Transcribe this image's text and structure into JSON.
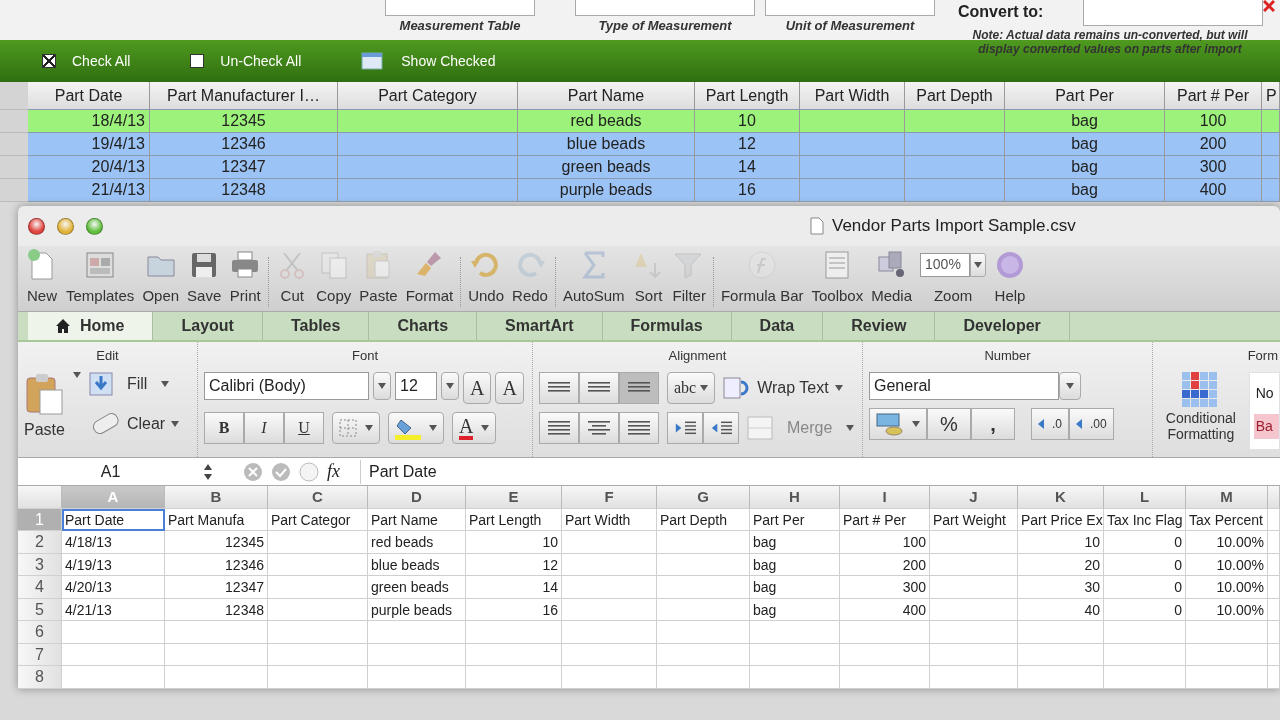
{
  "background_app": {
    "field_labels": [
      "Measurement Table",
      "Type of Measurement",
      "Unit of Measurement"
    ],
    "convert_label": "Convert to:",
    "note": "Note: Actual data remains un-converted, but will display converted values on parts after import",
    "controls": [
      {
        "kind": "checkbox",
        "label": "Check All",
        "checked": true
      },
      {
        "kind": "checkbox",
        "label": "Un-Check All",
        "checked": false
      },
      {
        "kind": "button",
        "label": "Show Checked"
      }
    ],
    "table": {
      "columns": [
        "Part Date",
        "Part Manufacturer I…",
        "Part Category",
        "Part Name",
        "Part Length",
        "Part Width",
        "Part Depth",
        "Part Per",
        "Part # Per",
        "P"
      ],
      "rows": [
        {
          "selected": true,
          "part_date": "18/4/13",
          "part_manufacturer": "12345",
          "part_name": "red beads",
          "part_length": "10",
          "part_per": "bag",
          "part_num_per": "100"
        },
        {
          "selected": false,
          "part_date": "19/4/13",
          "part_manufacturer": "12346",
          "part_name": "blue beads",
          "part_length": "12",
          "part_per": "bag",
          "part_num_per": "200"
        },
        {
          "selected": false,
          "part_date": "20/4/13",
          "part_manufacturer": "12347",
          "part_name": "green beads",
          "part_length": "14",
          "part_per": "bag",
          "part_num_per": "300"
        },
        {
          "selected": false,
          "part_date": "21/4/13",
          "part_manufacturer": "12348",
          "part_name": "purple beads",
          "part_length": "16",
          "part_per": "bag",
          "part_num_per": "400"
        }
      ]
    }
  },
  "excel": {
    "title": "Vendor Parts Import Sample.csv",
    "toolbar": [
      {
        "label": "New",
        "disabled": false
      },
      {
        "label": "Templates",
        "disabled": false
      },
      {
        "label": "Open",
        "disabled": false
      },
      {
        "label": "Save",
        "disabled": false
      },
      {
        "label": "Print",
        "disabled": false
      },
      {
        "label": "Cut",
        "disabled": true
      },
      {
        "label": "Copy",
        "disabled": true
      },
      {
        "label": "Paste",
        "disabled": true
      },
      {
        "label": "Format",
        "disabled": false
      },
      {
        "label": "Undo",
        "disabled": false
      },
      {
        "label": "Redo",
        "disabled": true
      },
      {
        "label": "AutoSum",
        "disabled": true
      },
      {
        "label": "Sort",
        "disabled": true
      },
      {
        "label": "Filter",
        "disabled": true
      },
      {
        "label": "Formula Bar",
        "disabled": true
      },
      {
        "label": "Toolbox",
        "disabled": false
      },
      {
        "label": "Media",
        "disabled": false
      },
      {
        "label": "Zoom",
        "disabled": false
      },
      {
        "label": "Help",
        "disabled": false
      }
    ],
    "zoom_value": "100%",
    "tabs": [
      {
        "label": "Home",
        "selected": true
      },
      {
        "label": "Layout",
        "selected": false
      },
      {
        "label": "Tables",
        "selected": false
      },
      {
        "label": "Charts",
        "selected": false
      },
      {
        "label": "SmartArt",
        "selected": false
      },
      {
        "label": "Formulas",
        "selected": false
      },
      {
        "label": "Data",
        "selected": false
      },
      {
        "label": "Review",
        "selected": false
      },
      {
        "label": "Developer",
        "selected": false
      }
    ],
    "ribbon": {
      "group_titles": [
        "Edit",
        "Font",
        "Alignment",
        "Number",
        "Form"
      ],
      "paste": "Paste",
      "fill": "Fill",
      "clear": "Clear",
      "font_name": "Calibri (Body)",
      "font_size": "12",
      "grow_font": "A",
      "shrink_font": "A",
      "bold": "B",
      "italic": "I",
      "underline": "U",
      "font_color": "A",
      "orientation": "abc",
      "wrap_text": "Wrap Text",
      "merge": {
        "label": "Merge",
        "disabled": true
      },
      "number_format": "General",
      "percent": "%",
      "comma": ",",
      "increase_decimal": ".00",
      "decrease_decimal": ".0",
      "conditional_formatting": "Conditional Formatting",
      "styles": [
        "No",
        "Ba"
      ]
    },
    "formula_bar": {
      "name_box": "A1",
      "fx": "fx",
      "value": "Part Date"
    },
    "sheet": {
      "columns": [
        {
          "letter": "A",
          "selected": true
        },
        {
          "letter": "B",
          "selected": false
        },
        {
          "letter": "C",
          "selected": false
        },
        {
          "letter": "D",
          "selected": false
        },
        {
          "letter": "E",
          "selected": false
        },
        {
          "letter": "F",
          "selected": false
        },
        {
          "letter": "G",
          "selected": false
        },
        {
          "letter": "H",
          "selected": false
        },
        {
          "letter": "I",
          "selected": false
        },
        {
          "letter": "J",
          "selected": false
        },
        {
          "letter": "K",
          "selected": false
        },
        {
          "letter": "L",
          "selected": false
        },
        {
          "letter": "M",
          "selected": false
        }
      ],
      "rows": [
        {
          "number": "1",
          "selected": true,
          "cells": {
            "A": "Part Date",
            "B": "Part Manufa",
            "C": "Part Categor",
            "D": "Part Name",
            "E": "Part Length",
            "F": "Part Width",
            "G": "Part Depth",
            "H": "Part Per",
            "I": "Part # Per",
            "J": "Part Weight",
            "K": "Part Price Ex",
            "L": "Tax Inc Flag",
            "M": "Tax Percent"
          }
        },
        {
          "number": "2",
          "selected": false,
          "cells": {
            "A": "4/18/13",
            "B": "12345",
            "D": "red beads",
            "E": "10",
            "H": "bag",
            "I": "100",
            "K": "10",
            "L": "0",
            "M": "10.00%"
          }
        },
        {
          "number": "3",
          "selected": false,
          "cells": {
            "A": "4/19/13",
            "B": "12346",
            "D": "blue beads",
            "E": "12",
            "H": "bag",
            "I": "200",
            "K": "20",
            "L": "0",
            "M": "10.00%"
          }
        },
        {
          "number": "4",
          "selected": false,
          "cells": {
            "A": "4/20/13",
            "B": "12347",
            "D": "green beads",
            "E": "14",
            "H": "bag",
            "I": "300",
            "K": "30",
            "L": "0",
            "M": "10.00%"
          }
        },
        {
          "number": "5",
          "selected": false,
          "cells": {
            "A": "4/21/13",
            "B": "12348",
            "D": "purple beads",
            "E": "16",
            "H": "bag",
            "I": "400",
            "K": "40",
            "L": "0",
            "M": "10.00%"
          }
        },
        {
          "number": "6",
          "selected": false
        },
        {
          "number": "7",
          "selected": false
        },
        {
          "number": "8",
          "selected": false
        }
      ]
    }
  }
}
